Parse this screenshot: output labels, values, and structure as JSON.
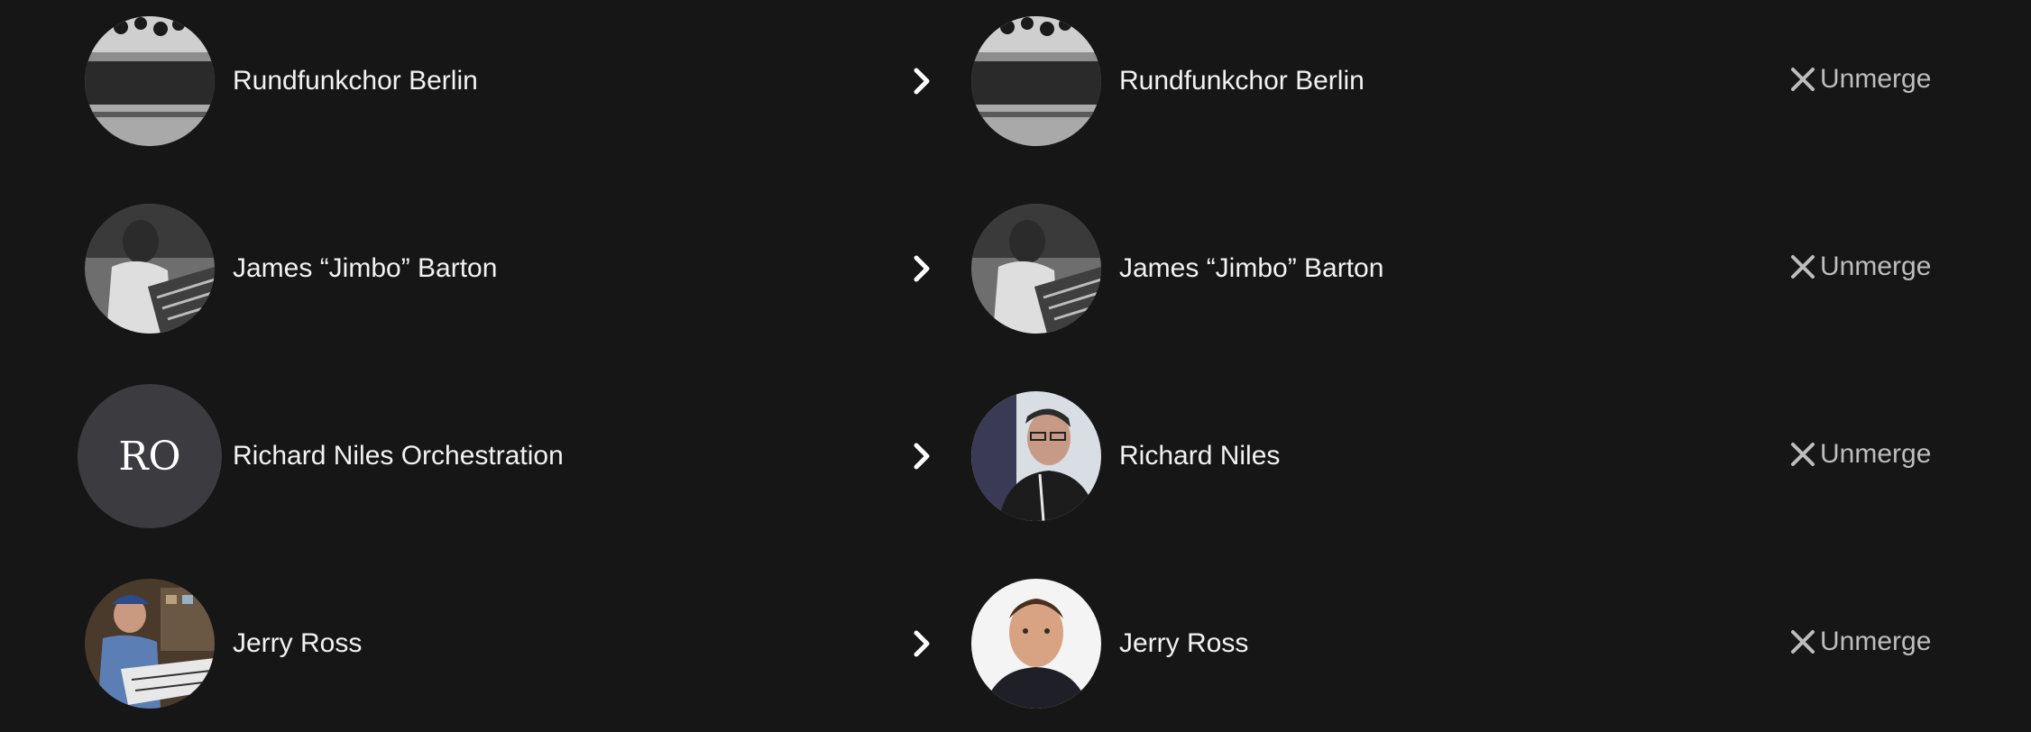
{
  "merges": [
    {
      "source": {
        "name": "Rundfunkchor Berlin",
        "avatar": "photo-choir-stage"
      },
      "target": {
        "name": "Rundfunkchor Berlin",
        "avatar": "photo-choir-stage"
      },
      "action_label": "Unmerge",
      "action_icon": "close-icon",
      "arrow_icon": "chevron-right-icon"
    },
    {
      "source": {
        "name": "James “Jimbo” Barton",
        "avatar": "photo-engineer-console"
      },
      "target": {
        "name": "James “Jimbo” Barton",
        "avatar": "photo-engineer-console"
      },
      "action_label": "Unmerge",
      "action_icon": "close-icon",
      "arrow_icon": "chevron-right-icon"
    },
    {
      "source": {
        "name": "Richard Niles Orchestration",
        "avatar_initials": "RO",
        "avatar_color": "#3c3b3f"
      },
      "target": {
        "name": "Richard Niles",
        "avatar": "photo-man-glasses"
      },
      "action_label": "Unmerge",
      "action_icon": "close-icon",
      "arrow_icon": "chevron-right-icon"
    },
    {
      "source": {
        "name": "Jerry Ross",
        "avatar": "photo-man-keyboard-studio"
      },
      "target": {
        "name": "Jerry Ross",
        "avatar": "photo-man-portrait"
      },
      "action_label": "Unmerge",
      "action_icon": "close-icon",
      "arrow_icon": "chevron-right-icon"
    }
  ],
  "colors": {
    "background": "#161616",
    "name_text": "#f2f2f2",
    "action_text": "#bdbdbd",
    "initials_avatar": "#3c3b3f"
  }
}
